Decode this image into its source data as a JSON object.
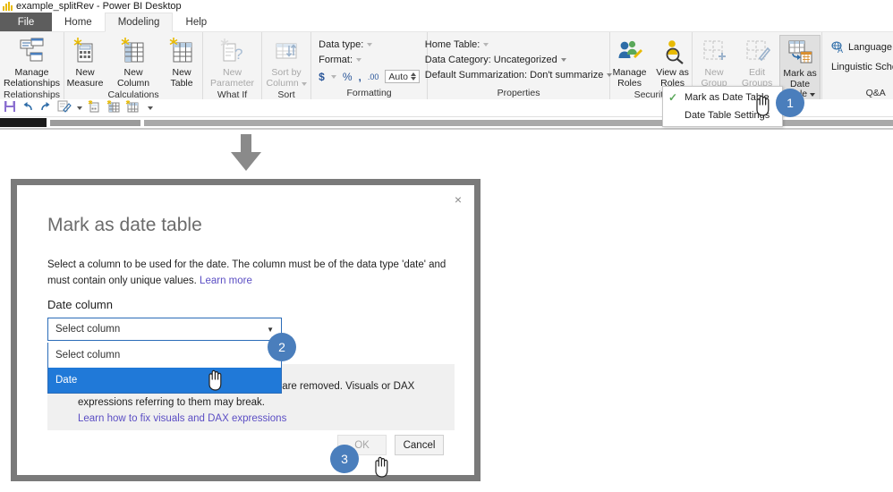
{
  "window": {
    "title": "example_splitRev - Power BI Desktop",
    "logo_icon": "power-bi-logo-icon"
  },
  "tabs": [
    {
      "label": "File",
      "active": false,
      "kind": "file"
    },
    {
      "label": "Home",
      "active": false,
      "kind": "normal"
    },
    {
      "label": "Modeling",
      "active": true,
      "kind": "normal"
    },
    {
      "label": "Help",
      "active": false,
      "kind": "normal"
    }
  ],
  "ribbon": {
    "groups": [
      {
        "name": "relationships",
        "label": "Relationships",
        "buttons": [
          {
            "name": "manage-relationships",
            "line1": "Manage",
            "line2": "Relationships",
            "icon": "manage-relationships-icon",
            "disabled": false
          }
        ]
      },
      {
        "name": "calculations",
        "label": "Calculations",
        "buttons": [
          {
            "name": "new-measure",
            "line1": "New",
            "line2": "Measure",
            "icon": "new-measure-icon",
            "disabled": false
          },
          {
            "name": "new-column",
            "line1": "New",
            "line2": "Column",
            "icon": "new-column-icon",
            "disabled": false
          },
          {
            "name": "new-table",
            "line1": "New",
            "line2": "Table",
            "icon": "new-table-icon",
            "disabled": false
          }
        ]
      },
      {
        "name": "what-if",
        "label": "What If",
        "buttons": [
          {
            "name": "new-parameter",
            "line1": "New",
            "line2": "Parameter",
            "icon": "new-parameter-icon",
            "disabled": true
          }
        ]
      },
      {
        "name": "sort",
        "label": "Sort",
        "buttons": [
          {
            "name": "sort-by-column",
            "line1": "Sort by",
            "line2": "Column",
            "icon": "sort-by-column-icon",
            "disabled": true,
            "has_caret": true
          }
        ]
      }
    ],
    "formatting": {
      "label": "Formatting",
      "data_type_label": "Data type:",
      "format_label": "Format:",
      "currency_symbol": "$",
      "percent_symbol": "%",
      "comma_symbol": ",",
      "decimal_symbol": ".00",
      "auto_value": "Auto"
    },
    "properties": {
      "label": "Properties",
      "home_table_label": "Home Table:",
      "data_category_label": "Data Category: Uncategorized",
      "default_summarization_label": "Default Summarization: Don't summarize"
    },
    "security": {
      "label": "Security",
      "buttons": [
        {
          "name": "manage-roles",
          "line1": "Manage",
          "line2": "Roles",
          "icon": "manage-roles-icon",
          "disabled": false
        },
        {
          "name": "view-as-roles",
          "line1": "View as",
          "line2": "Roles",
          "icon": "view-as-roles-icon",
          "disabled": false
        }
      ]
    },
    "calendars": {
      "label": "",
      "buttons": [
        {
          "name": "new-group",
          "line1": "New",
          "line2": "Group",
          "icon": "new-group-icon",
          "disabled": true
        },
        {
          "name": "edit-groups",
          "line1": "Edit",
          "line2": "Groups",
          "icon": "edit-groups-icon",
          "disabled": true
        },
        {
          "name": "mark-as-date-table",
          "line1": "Mark as",
          "line2": "Date Table",
          "icon": "mark-as-date-table-icon",
          "disabled": false,
          "pressed": true,
          "has_caret": true
        }
      ]
    },
    "qanda": {
      "label": "Q&A",
      "language_label": "Language",
      "linguistic_schema_label": "Linguistic Schema",
      "language_icon": "language-icon"
    }
  },
  "menu": {
    "items": [
      {
        "label": "Mark as Date Table",
        "checked": true
      },
      {
        "label": "Date Table Settings",
        "checked": false
      }
    ]
  },
  "qat": {
    "items": [
      {
        "name": "save-icon",
        "label": "save-icon"
      },
      {
        "name": "undo-icon",
        "label": "undo-icon"
      },
      {
        "name": "redo-icon",
        "label": "redo-icon"
      },
      {
        "name": "edit-queries-icon",
        "label": "edit-queries-icon"
      },
      {
        "name": "new-measure-small-icon",
        "label": "new-measure-small-icon"
      },
      {
        "name": "new-column-small-icon",
        "label": "new-column-small-icon"
      },
      {
        "name": "new-table-small-icon",
        "label": "new-table-small-icon"
      },
      {
        "name": "customize-qat-icon",
        "label": "customize-qat-icon"
      }
    ]
  },
  "dialog": {
    "close_label": "×",
    "title": "Mark as date table",
    "description_part1": "Select a column to be used for the date. The column must be of the data type 'date' and must contain only unique values. ",
    "learn_more_label": "Learn more",
    "field_label": "Date column",
    "select": {
      "value": "Select column",
      "placeholder": "Select column",
      "options": [
        {
          "label": "Select column",
          "selected": false
        },
        {
          "label": "Date",
          "selected": true
        }
      ]
    },
    "warning_text": "te tables that were associated with this table are removed. Visuals or DAX expressions referring to them may break.",
    "warning_link": "Learn how to fix visuals and DAX expressions",
    "ok_label": "OK",
    "cancel_label": "Cancel"
  },
  "callouts": [
    {
      "id": "1",
      "label": "1"
    },
    {
      "id": "2",
      "label": "2"
    },
    {
      "id": "3",
      "label": "3"
    }
  ],
  "colors": {
    "badge_blue": "#4a7ebc",
    "selected_blue": "#2079d8",
    "link_purple": "#5b4ec4",
    "file_tab_gray": "#5d5d5d",
    "ribbon_bg": "#f4f4f4",
    "dialog_border_gray": "#7a7a7a",
    "arrow_gray": "#8a8a8a"
  }
}
